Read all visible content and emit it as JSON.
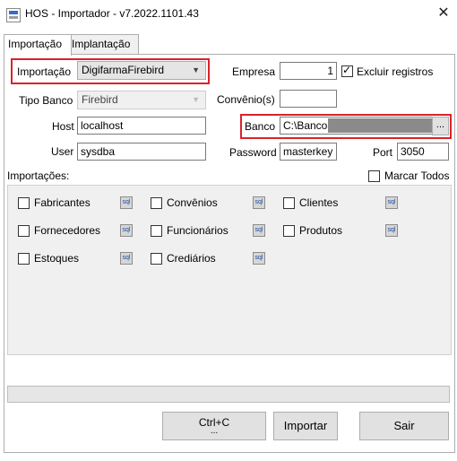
{
  "window": {
    "title": "HOS - Importador - v7.2022.1101.43",
    "close_glyph": "✕"
  },
  "tabs": [
    {
      "label": "Importação",
      "active": true
    },
    {
      "label": "Implantação",
      "active": false
    }
  ],
  "form": {
    "importacao": {
      "label": "Importação",
      "value": "DigifarmaFirebird"
    },
    "tipo_banco": {
      "label": "Tipo Banco",
      "value": "Firebird"
    },
    "host": {
      "label": "Host",
      "value": "localhost"
    },
    "user": {
      "label": "User",
      "value": "sysdba"
    },
    "empresa": {
      "label": "Empresa",
      "value": "1"
    },
    "excluir": {
      "label": "Excluir registros",
      "checked": true
    },
    "convenio": {
      "label": "Convênio(s)",
      "value": ""
    },
    "banco": {
      "label": "Banco",
      "value": "C:\\Bancos\\",
      "browse": "..."
    },
    "password": {
      "label": "Password",
      "value": "masterkey"
    },
    "port": {
      "label": "Port",
      "value": "3050"
    }
  },
  "importacoes": {
    "label": "Importações:",
    "marcar_todos": "Marcar Todos",
    "items": [
      {
        "label": "Fabricantes",
        "checked": false,
        "icon": "sql-icon",
        "icon_text": "sql"
      },
      {
        "label": "Convênios",
        "checked": false,
        "icon": "sql-icon",
        "icon_text": "sql"
      },
      {
        "label": "Clientes",
        "checked": false,
        "icon": "sql-icon",
        "icon_text": "sql"
      },
      {
        "label": "Fornecedores",
        "checked": false,
        "icon": "sql-icon",
        "icon_text": "sql"
      },
      {
        "label": "Funcionários",
        "checked": false,
        "icon": "sql-icon",
        "icon_text": "sql"
      },
      {
        "label": "Produtos",
        "checked": false,
        "icon": "sql-icon",
        "icon_text": "sql"
      },
      {
        "label": "Estoques",
        "checked": false,
        "icon": "sql-icon",
        "icon_text": "sql"
      },
      {
        "label": "Crediários",
        "checked": false,
        "icon": "sql-icon",
        "icon_text": "sql"
      }
    ]
  },
  "progress": {
    "value": 0
  },
  "buttons": {
    "ctrlc": "Ctrl+C",
    "ctrlc_sub": "...",
    "importar": "Importar",
    "sair": "Sair"
  },
  "colors": {
    "highlight_red": "#d9232b",
    "panel_bg": "#f0f0f0",
    "button_bg": "#e1e1e1"
  }
}
